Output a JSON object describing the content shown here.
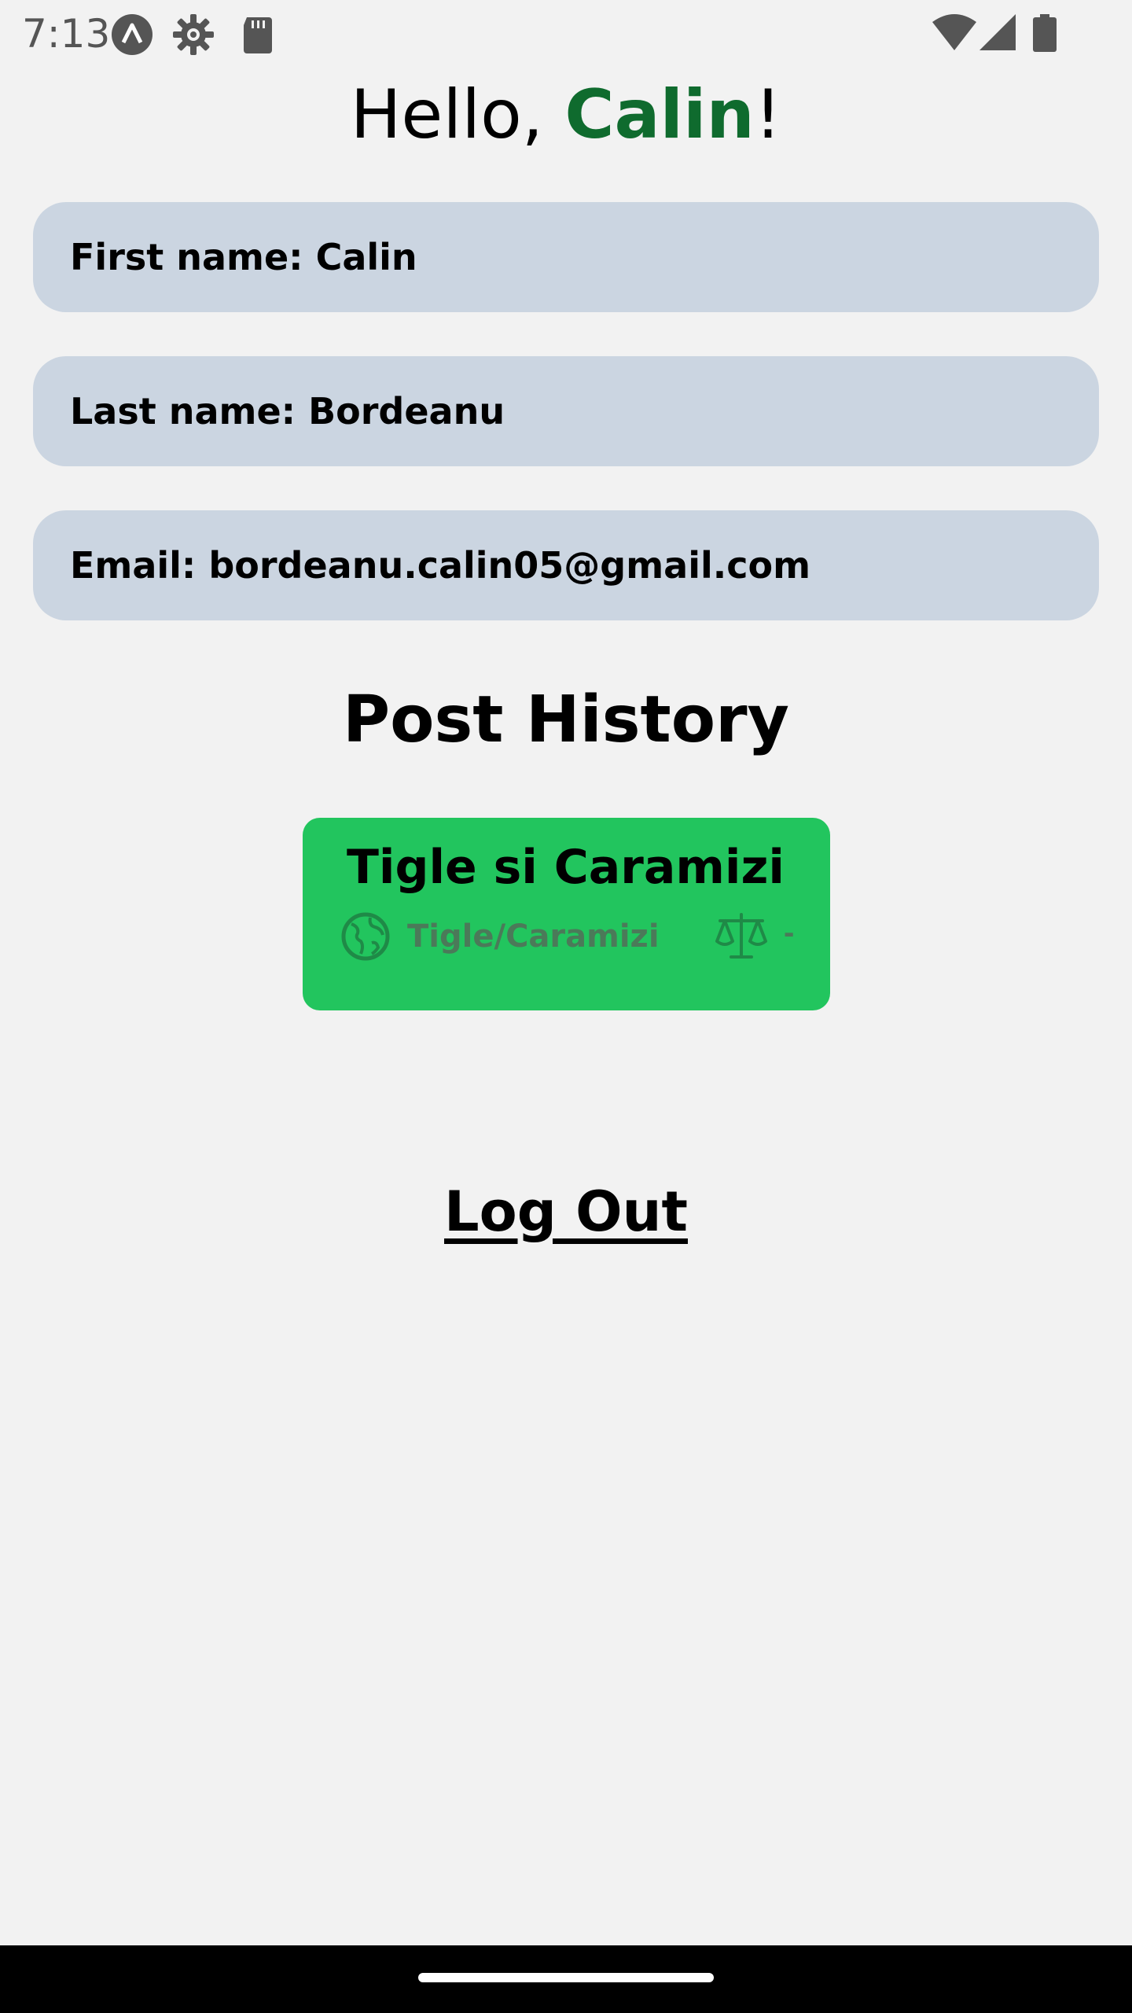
{
  "status_bar": {
    "time": "7:13",
    "icons": [
      "launcher-icon",
      "settings-gear-icon",
      "sd-card-icon",
      "wifi-icon",
      "cellular-signal-icon",
      "battery-icon"
    ]
  },
  "greeting": {
    "prefix": "Hello, ",
    "name": "Calin",
    "suffix": "!",
    "name_color": "#0f6b2e"
  },
  "profile": {
    "first_name": "First name: Calin",
    "last_name": "Last name: Bordeanu",
    "email": "Email: bordeanu.calin05@gmail.com"
  },
  "post_history": {
    "title": "Post History",
    "posts": [
      {
        "title": "Tigle si Caramizi",
        "category": "Tigle/Caramizi",
        "value": "-",
        "card_color": "#22c55e"
      }
    ]
  },
  "logout_label": "Log Out"
}
